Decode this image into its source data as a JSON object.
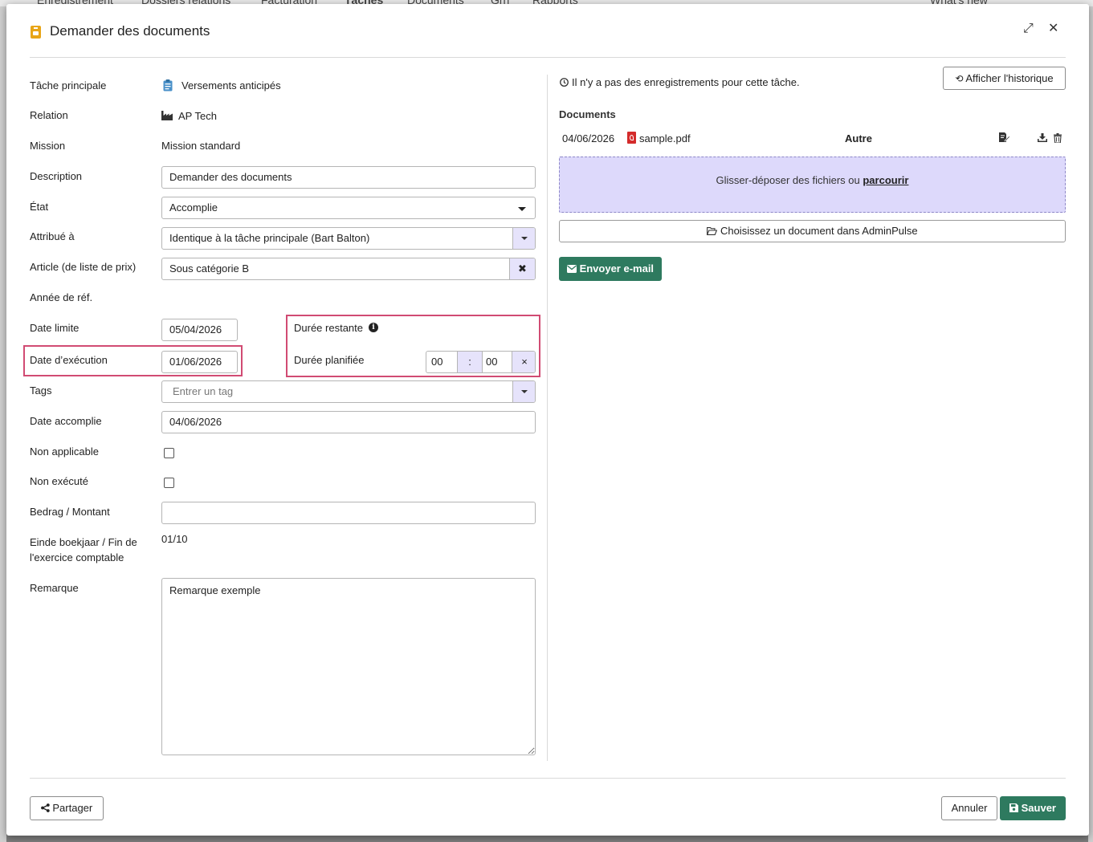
{
  "background_nav": [
    "Enregistrement",
    "Dossiers relations",
    "Facturation",
    "Tâches",
    "Documents",
    "Grh",
    "Rapports",
    "What's new"
  ],
  "dialog": {
    "title": "Demander des documents",
    "expand_glyph": "⤢",
    "close_glyph": "✕"
  },
  "form": {
    "tache_principale": {
      "label": "Tâche principale",
      "value": "Versements anticipés",
      "icon": "clipboard-icon"
    },
    "relation": {
      "label": "Relation",
      "value": "AP Tech",
      "icon": "industry-icon"
    },
    "mission": {
      "label": "Mission",
      "value": "Mission standard"
    },
    "description": {
      "label": "Description",
      "value": "Demander des documents"
    },
    "etat": {
      "label": "État",
      "value": "Accomplie"
    },
    "attribue": {
      "label": "Attribué à",
      "value": "Identique à la tâche principale (Bart Balton)"
    },
    "article": {
      "label": "Article (de liste de prix)",
      "value": "Sous catégorie B",
      "clear": "✖"
    },
    "annee_ref": {
      "label": "Année de réf."
    },
    "date_limite": {
      "label": "Date limite",
      "value": "05/04/2026"
    },
    "date_execution": {
      "label": "Date d’exécution",
      "value": "01/06/2026"
    },
    "duree_restante": {
      "label": "Durée restante",
      "info": "i"
    },
    "duree_planifiee": {
      "label": "Durée planifiée",
      "hours": "00",
      "sep": ":",
      "minutes": "00",
      "clear": "×"
    },
    "tags": {
      "label": "Tags",
      "placeholder": "Entrer un tag"
    },
    "date_accomplie": {
      "label": "Date accomplie",
      "value": "04/06/2026"
    },
    "non_applicable": {
      "label": "Non applicable",
      "checked": false
    },
    "non_execute": {
      "label": "Non exécuté",
      "checked": false
    },
    "montant": {
      "label": "Bedrag / Montant",
      "value": ""
    },
    "fin_exercice": {
      "label_line1": "Einde boekjaar / Fin de",
      "label_line2": "l'exercice comptable",
      "value": "01/10"
    },
    "remarque": {
      "label": "Remarque",
      "value": "Remarque exemple"
    }
  },
  "right_panel": {
    "history_notice": "Il n'y a pas des enregistrements pour cette tâche.",
    "history_button": "Afficher l'historique",
    "documents_heading": "Documents",
    "documents": [
      {
        "date": "04/06/2026",
        "filename": "sample.pdf",
        "category": "Autre"
      }
    ],
    "dropzone_text": "Glisser-déposer des fichiers ou ",
    "dropzone_link": "parcourir",
    "choose_button": "Choisissez un document dans AdminPulse",
    "email_button": "Envoyer e-mail"
  },
  "footer": {
    "share": "Partager",
    "cancel": "Annuler",
    "save": "Sauver"
  },
  "colors": {
    "accent_green": "#2e7a5f",
    "highlight_pink": "#d14b73",
    "lavender": "#e6e3fb",
    "title_icon": "#e8a517"
  }
}
